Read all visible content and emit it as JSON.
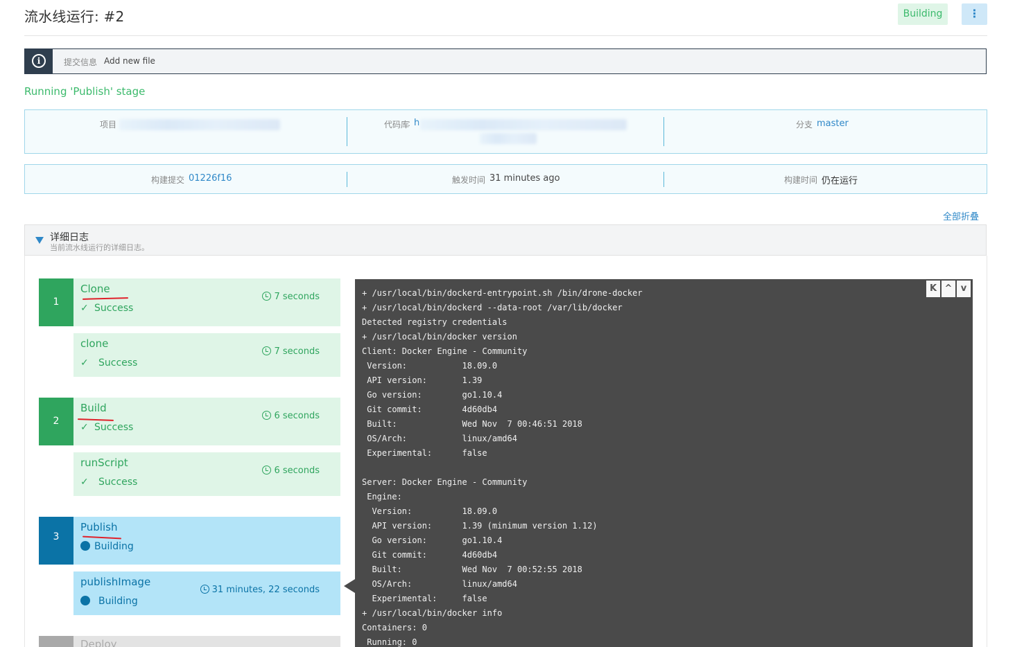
{
  "header": {
    "title": "流水线运行: #2",
    "status": "Building",
    "more_icon": "⋮"
  },
  "commit": {
    "label": "提交信息",
    "message": "Add new file"
  },
  "stage_status": "Running 'Publish' stage",
  "info_row1": {
    "project_label": "项目",
    "repo_label": "代码库",
    "repo_prefix": "h",
    "branch_label": "分支",
    "branch_value": "master"
  },
  "info_row2": {
    "commit_label": "构建提交",
    "commit_value": "01226f16",
    "trigger_label": "触发时间",
    "trigger_value": "31 minutes ago",
    "duration_label": "构建时间",
    "duration_value": "仍在运行"
  },
  "collapse_all": "全部折叠",
  "log_section": {
    "title": "详细日志",
    "subtitle": "当前流水线运行的详细日志。"
  },
  "stages": [
    {
      "num": "1",
      "name": "Clone",
      "status": "Success",
      "duration": "7 seconds"
    },
    {
      "num": "2",
      "name": "Build",
      "status": "Success",
      "duration": "6 seconds"
    },
    {
      "num": "3",
      "name": "Publish",
      "status": "Building"
    },
    {
      "name": "Deploy"
    }
  ],
  "steps": [
    {
      "name": "clone",
      "status": "Success",
      "duration": "7 seconds"
    },
    {
      "name": "runScript",
      "status": "Success",
      "duration": "6 seconds"
    },
    {
      "name": "publishImage",
      "status": "Building",
      "duration": "31 minutes, 22 seconds"
    }
  ],
  "terminal": {
    "buttons": [
      "K",
      "^",
      "v"
    ],
    "lines": [
      "+ /usr/local/bin/dockerd-entrypoint.sh /bin/drone-docker",
      "+ /usr/local/bin/dockerd --data-root /var/lib/docker",
      "Detected registry credentials",
      "+ /usr/local/bin/docker version",
      "Client: Docker Engine - Community",
      " Version:           18.09.0",
      " API version:       1.39",
      " Go version:        go1.10.4",
      " Git commit:        4d60db4",
      " Built:             Wed Nov  7 00:46:51 2018",
      " OS/Arch:           linux/amd64",
      " Experimental:      false",
      "",
      "Server: Docker Engine - Community",
      " Engine:",
      "  Version:          18.09.0",
      "  API version:      1.39 (minimum version 1.12)",
      "  Go version:       go1.10.4",
      "  Git commit:       4d60db4",
      "  Built:            Wed Nov  7 00:52:55 2018",
      "  OS/Arch:          linux/amd64",
      "  Experimental:     false",
      "+ /usr/local/bin/docker info",
      "Containers: 0",
      " Running: 0"
    ]
  }
}
